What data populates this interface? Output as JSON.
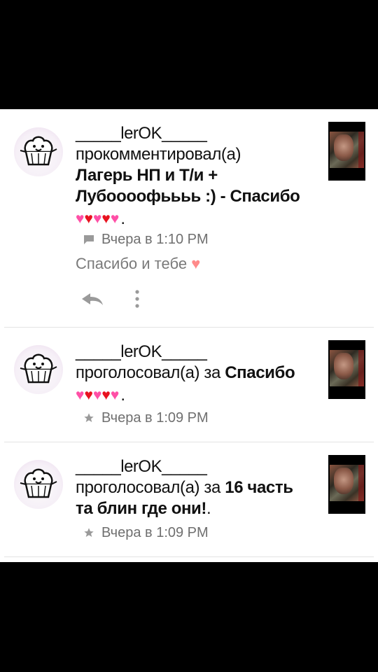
{
  "notifications": [
    {
      "username": "_____lerOK_____",
      "action": "прокомментировал(а)",
      "target_line1": "Лагерь НП и Т/и +",
      "target_line2": "Лубоооофьььь :) - Спасибо",
      "target_suffix": ".",
      "hearts": [
        "pink",
        "red",
        "pink",
        "red",
        "pink"
      ],
      "meta_icon": "comment-icon",
      "timestamp": "Вчера в 1:10 PM",
      "reply": "Спасибо и тебе",
      "reply_emoji": "heart",
      "reply_action_icon": "reply-icon",
      "more_icon": "more-vertical-icon"
    },
    {
      "username": "_____lerOK_____",
      "action": "проголосовал(а) за",
      "target": "Спасибо",
      "target_suffix": ".",
      "hearts": [
        "pink",
        "red",
        "pink",
        "red",
        "pink"
      ],
      "meta_icon": "star-icon",
      "timestamp": "Вчера в 1:09 PM"
    },
    {
      "username": "_____lerOK_____",
      "action": "проголосовал(а) за",
      "target": "16 часть",
      "target_line2": "та блин где они!",
      "target_suffix": ".",
      "meta_icon": "star-icon",
      "timestamp": "Вчера в 1:09 PM"
    }
  ],
  "colors": {
    "background": "#ffffff",
    "text": "#111111",
    "meta": "#6f6f6f",
    "heart_pink": "#ff4fa6",
    "heart_red": "#e8121f",
    "divider": "#e3e3e3"
  }
}
